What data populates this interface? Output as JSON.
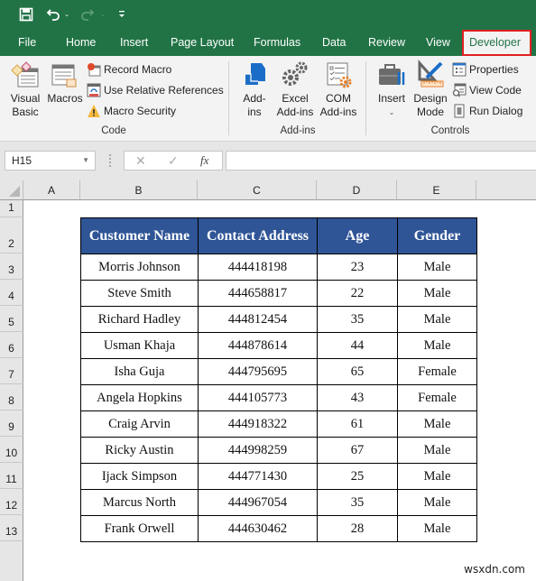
{
  "quick_access": {
    "save": "save-icon",
    "undo": "undo-icon",
    "redo": "redo-icon",
    "customize": "customize-qat-icon"
  },
  "tabs": [
    {
      "label": "File"
    },
    {
      "label": "Home"
    },
    {
      "label": "Insert"
    },
    {
      "label": "Page Layout"
    },
    {
      "label": "Formulas"
    },
    {
      "label": "Data"
    },
    {
      "label": "Review"
    },
    {
      "label": "View"
    },
    {
      "label": "Developer",
      "active": true
    }
  ],
  "ribbon": {
    "code": {
      "label": "Code",
      "visual_basic": [
        "Visual",
        "Basic"
      ],
      "macros": "Macros",
      "record_macro": "Record Macro",
      "relative_refs": "Use Relative References",
      "macro_security": "Macro Security"
    },
    "addins": {
      "label": "Add-ins",
      "addins": [
        "Add-",
        "ins"
      ],
      "excel_addins": [
        "Excel",
        "Add-ins"
      ],
      "com_addins": [
        "COM",
        "Add-ins"
      ]
    },
    "controls": {
      "label": "Controls",
      "insert": "Insert",
      "design_mode": [
        "Design",
        "Mode"
      ],
      "properties": "Properties",
      "view_code": "View Code",
      "run_dialog": "Run Dialog"
    }
  },
  "formula_bar": {
    "name_box": "H15",
    "fx": "fx",
    "value": ""
  },
  "grid": {
    "columns": [
      "A",
      "B",
      "C",
      "D",
      "E"
    ],
    "rows": [
      "1",
      "2",
      "3",
      "4",
      "5",
      "6",
      "7",
      "8",
      "9",
      "10",
      "11",
      "12",
      "13"
    ]
  },
  "table": {
    "headers": [
      "Customer Name",
      "Contact Address",
      "Age",
      "Gender"
    ],
    "rows": [
      [
        "Morris Johnson",
        "444418198",
        "23",
        "Male"
      ],
      [
        "Steve Smith",
        "444658817",
        "22",
        "Male"
      ],
      [
        "Richard Hadley",
        "444812454",
        "35",
        "Male"
      ],
      [
        "Usman Khaja",
        "444878614",
        "44",
        "Male"
      ],
      [
        "Isha Guja",
        "444795695",
        "65",
        "Female"
      ],
      [
        "Angela Hopkins",
        "444105773",
        "43",
        "Female"
      ],
      [
        "Craig Arvin",
        "444918322",
        "61",
        "Male"
      ],
      [
        "Ricky Austin",
        "444998259",
        "67",
        "Male"
      ],
      [
        "Ijack Simpson",
        "444771430",
        "25",
        "Male"
      ],
      [
        "Marcus North",
        "444967054",
        "35",
        "Male"
      ],
      [
        "Frank Orwell",
        "444630462",
        "28",
        "Male"
      ]
    ]
  },
  "colors": {
    "brand_green": "#217346",
    "header_blue": "#2f5597",
    "highlight_red": "#e02020"
  },
  "watermark": "wsxdn.com"
}
